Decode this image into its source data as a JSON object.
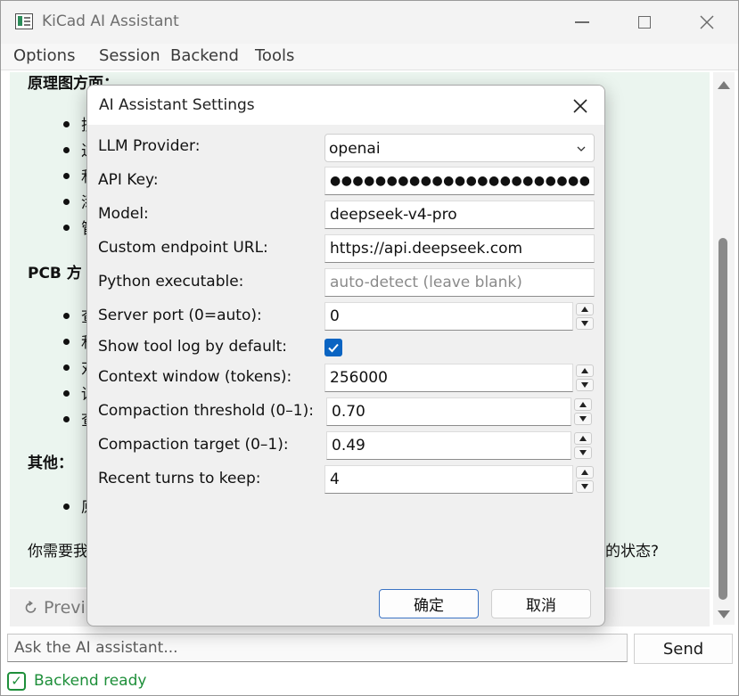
{
  "window": {
    "title": "KiCad AI Assistant"
  },
  "menu": [
    "Options",
    "Session",
    "Backend",
    "Tools"
  ],
  "chat": {
    "heading_schematic": "原理图方面：",
    "schematic_bullets": [
      "搜",
      "过",
      "和",
      "添",
      "管"
    ],
    "heading_pcb": "PCB 方",
    "pcb_bullets": [
      "查",
      "和",
      "对",
      "读",
      "查"
    ],
    "heading_other": "其他：",
    "other_bullets": [
      "原"
    ],
    "question_start": "你需要我",
    "question_end": "的状态?"
  },
  "previous_button": {
    "icon": "undo-arrow-icon",
    "label": "Previ"
  },
  "input": {
    "placeholder": "Ask the AI assistant..."
  },
  "send_button": {
    "label": "Send"
  },
  "status": {
    "text": "Backend ready",
    "color": "#1e8f3a"
  },
  "dialog": {
    "title": "AI Assistant Settings",
    "fields": {
      "provider": {
        "label": "LLM Provider:",
        "value": "openai"
      },
      "api_key": {
        "label": "API Key:",
        "value": "●●●●●●●●●●●●●●●●●●●●●●●●●●●●●●●"
      },
      "model": {
        "label": "Model:",
        "value": "deepseek-v4-pro"
      },
      "endpoint": {
        "label": "Custom endpoint URL:",
        "value": "https://api.deepseek.com"
      },
      "python": {
        "label": "Python executable:",
        "value": "",
        "placeholder": "auto-detect (leave blank)"
      },
      "port": {
        "label": "Server port (0=auto):",
        "value": "0"
      },
      "show_log": {
        "label": "Show tool log by default:",
        "checked": true
      },
      "context": {
        "label": "Context window (tokens):",
        "value": "256000"
      },
      "compaction_threshold": {
        "label": "Compaction threshold (0–1):",
        "value": "0.70"
      },
      "compaction_target": {
        "label": "Compaction target (0–1):",
        "value": "0.49"
      },
      "recent_turns": {
        "label": "Recent turns to keep:",
        "value": "4"
      }
    },
    "ok_label": "确定",
    "cancel_label": "取消",
    "accent_color": "#0a64c2"
  }
}
